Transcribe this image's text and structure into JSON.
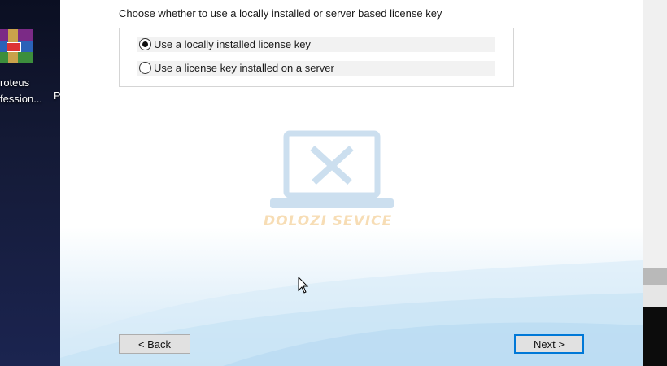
{
  "desktop": {
    "icon_label_line1": "roteus",
    "icon_label_line2": "fession...",
    "icon_label_partial": "P"
  },
  "dialog": {
    "prompt": "Choose whether to use a locally installed or server based license key",
    "options": [
      {
        "label": "Use a locally installed license key",
        "selected": true
      },
      {
        "label": "Use a license key installed on a server",
        "selected": false
      }
    ],
    "watermark_text": "DOLOZI SEVICE",
    "back_label": "< Back",
    "next_label": "Next >"
  }
}
